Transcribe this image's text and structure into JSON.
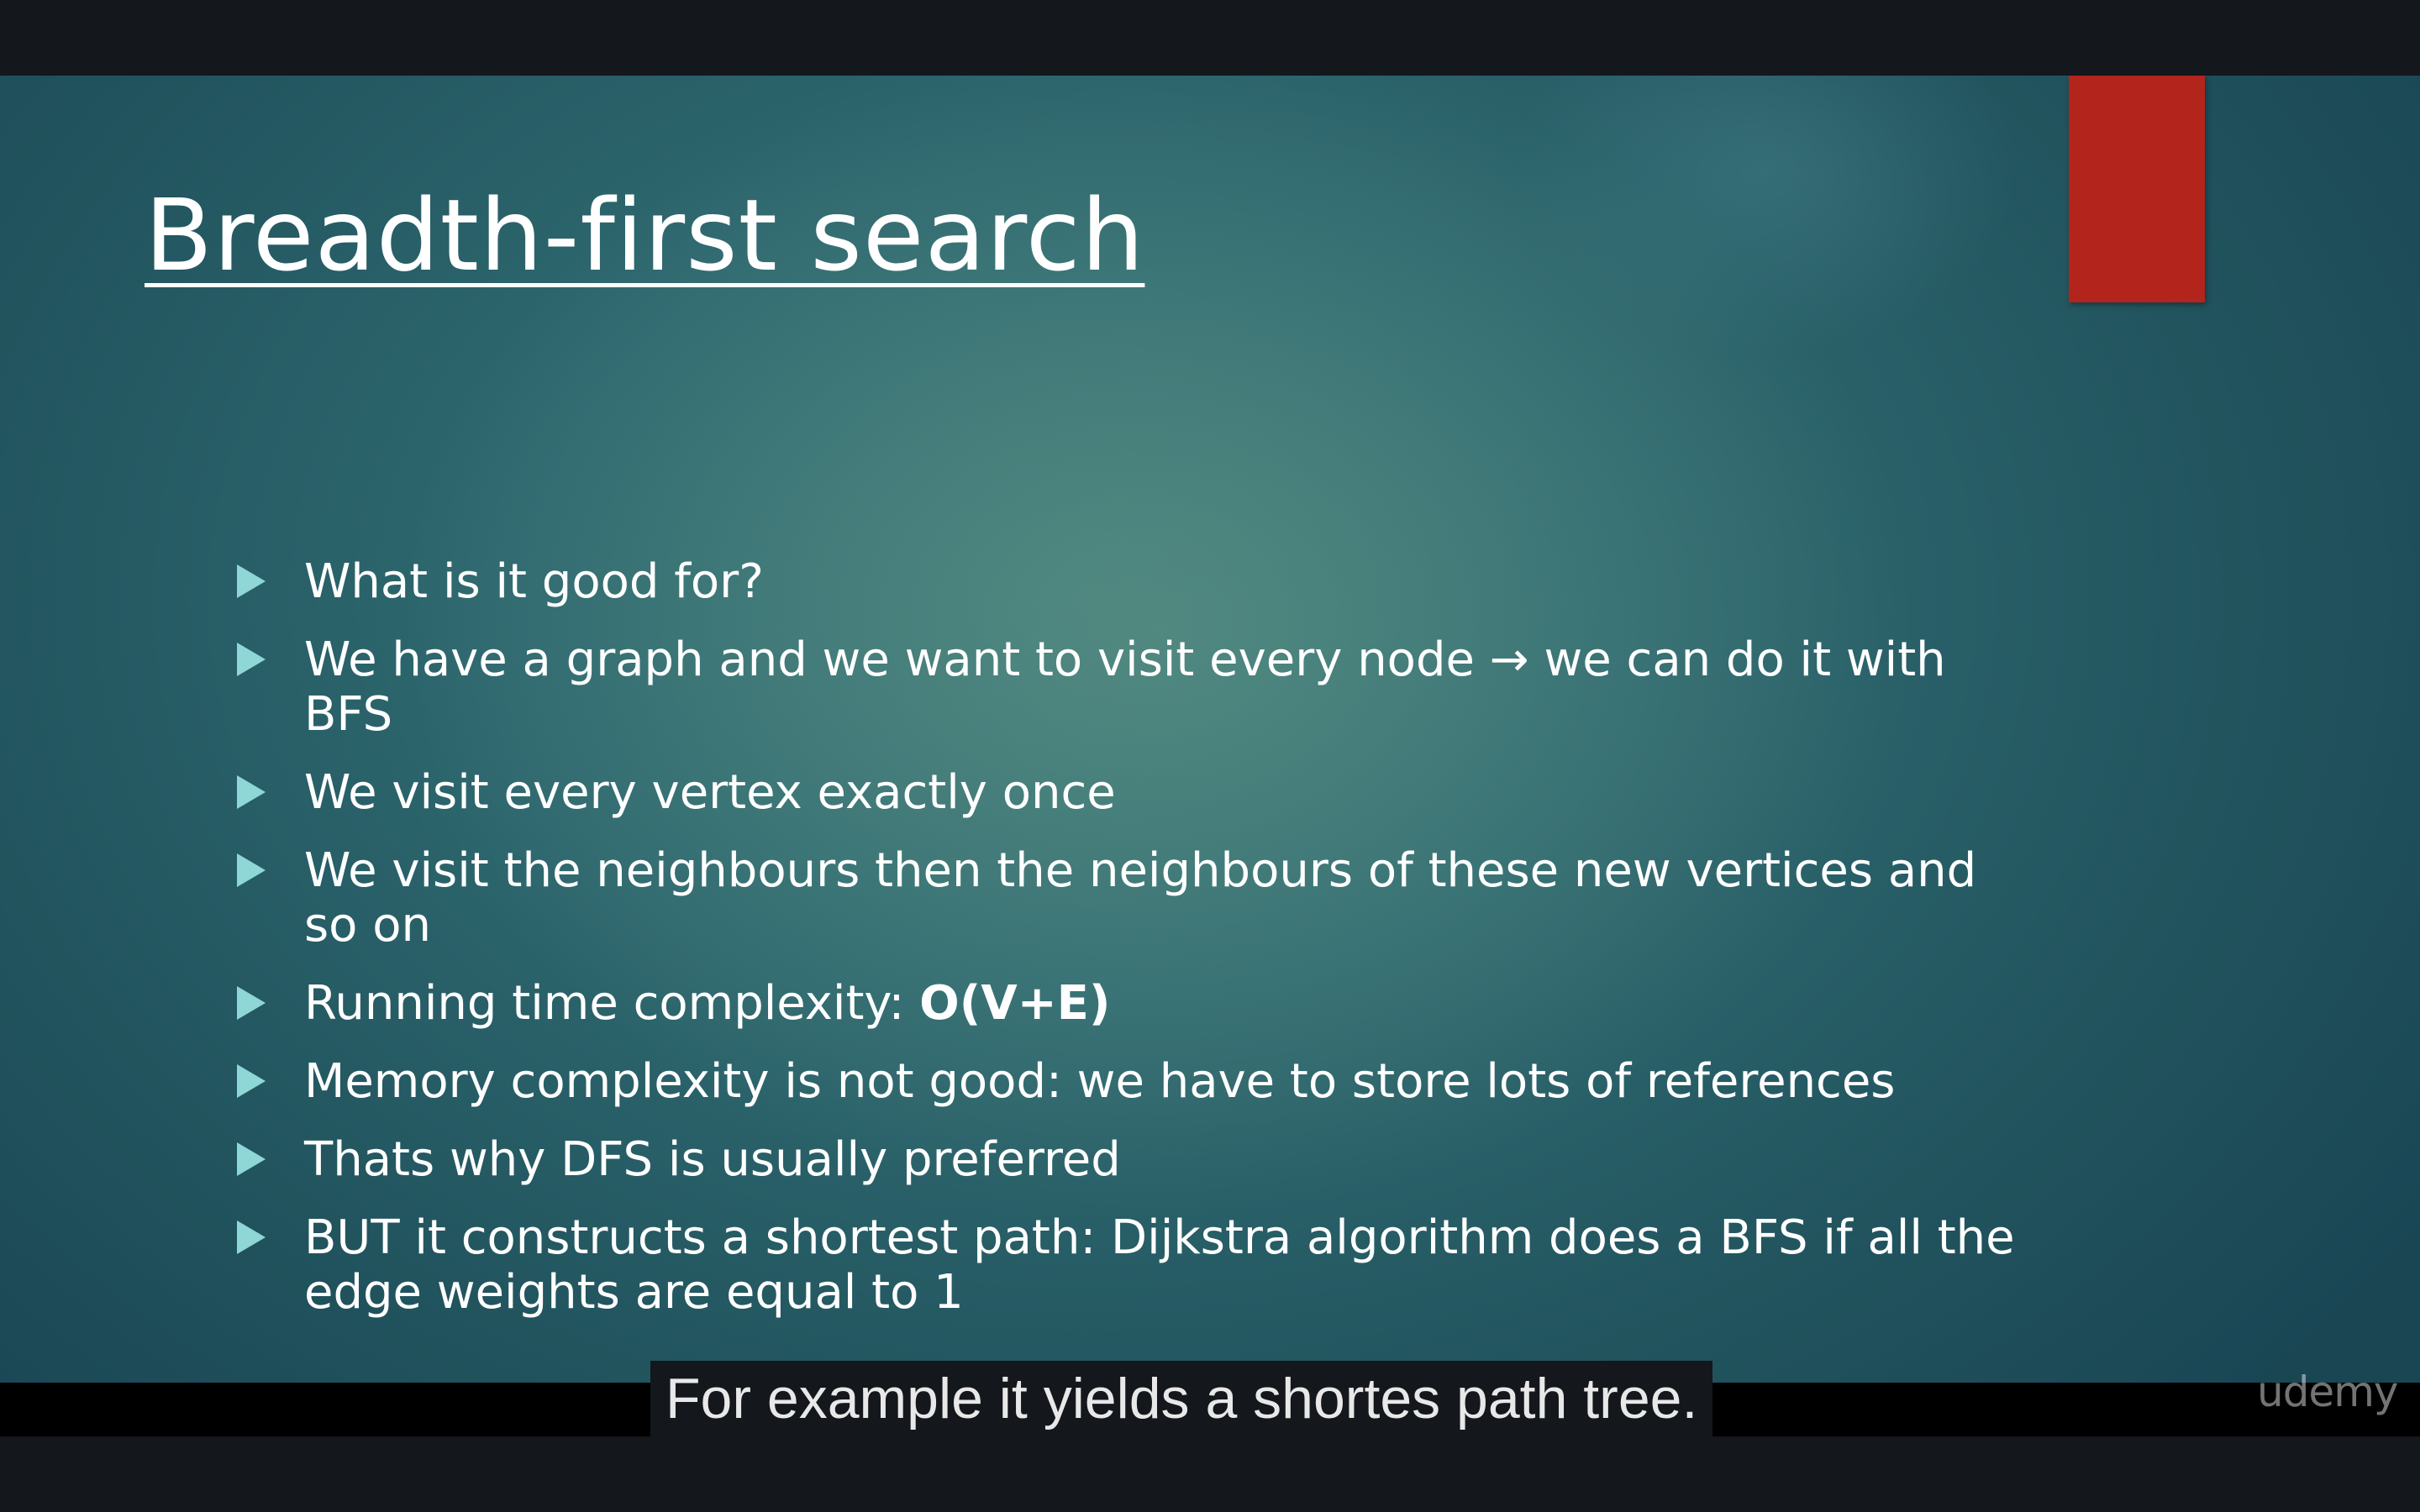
{
  "slide": {
    "title": "Breadth-first search",
    "accent_color": "#b3241c",
    "bullet_icon": "triangle-right-icon",
    "bullets": [
      {
        "text": "What is it good for?",
        "bold": ""
      },
      {
        "text": "We have a graph and we want to visit every node → we can do it with BFS",
        "bold": ""
      },
      {
        "text": "We visit every vertex exactly once",
        "bold": ""
      },
      {
        "text": "We visit the neighbours then the neighbours of these new vertices and so on",
        "bold": ""
      },
      {
        "text": "Running time complexity: ",
        "bold": "O(V+E)"
      },
      {
        "text": "Memory complexity is not good: we have to store lots of references",
        "bold": ""
      },
      {
        "text": "Thats why DFS is usually preferred",
        "bold": ""
      },
      {
        "text": "BUT it constructs a shortest path: Dijkstra algorithm does a BFS if all the edge weights are equal to 1",
        "bold": ""
      }
    ]
  },
  "caption": {
    "text": "For example it yields a shortes path tree."
  },
  "watermark": {
    "text": "udemy"
  }
}
